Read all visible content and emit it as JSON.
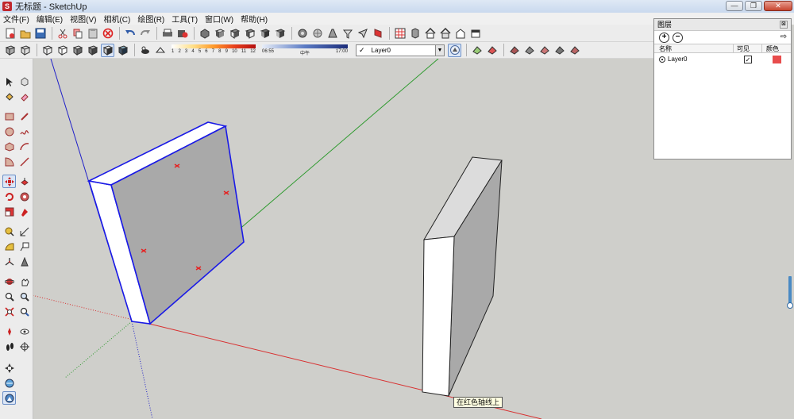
{
  "window": {
    "title": "无标题 - SketchUp",
    "app_icon_glyph": "S"
  },
  "window_controls": {
    "minimize": "—",
    "restore": "❐",
    "close": "✕"
  },
  "menu": [
    "文件(F)",
    "编辑(E)",
    "视图(V)",
    "相机(C)",
    "绘图(R)",
    "工具(T)",
    "窗口(W)",
    "帮助(H)"
  ],
  "shadow_ticks": [
    "1",
    "2",
    "3",
    "4",
    "5",
    "6",
    "7",
    "8",
    "9",
    "10",
    "11",
    "12"
  ],
  "time": {
    "start": "06:55",
    "mid": "中午",
    "end": "17:00"
  },
  "layer_toolbar": {
    "check": "✓",
    "current_layer": "Layer0",
    "arrow": "▼"
  },
  "layers_panel": {
    "title": "图层",
    "close": "⊠",
    "add": "+",
    "remove": "−",
    "detail": "⇨",
    "headers": {
      "name": "名称",
      "visible": "可见",
      "color": "颜色"
    },
    "rows": [
      {
        "name": "Layer0",
        "visible_mark": "✓",
        "color": "#e84c4c"
      }
    ]
  },
  "tooltip": "在红色轴线上",
  "colors": {
    "red_axis": "#d83030",
    "green_axis": "#2e9a2e",
    "blue_axis": "#2020c8",
    "face": "#a9a9a9",
    "face_light": "#ffffff",
    "selection": "#1a1ae6"
  }
}
